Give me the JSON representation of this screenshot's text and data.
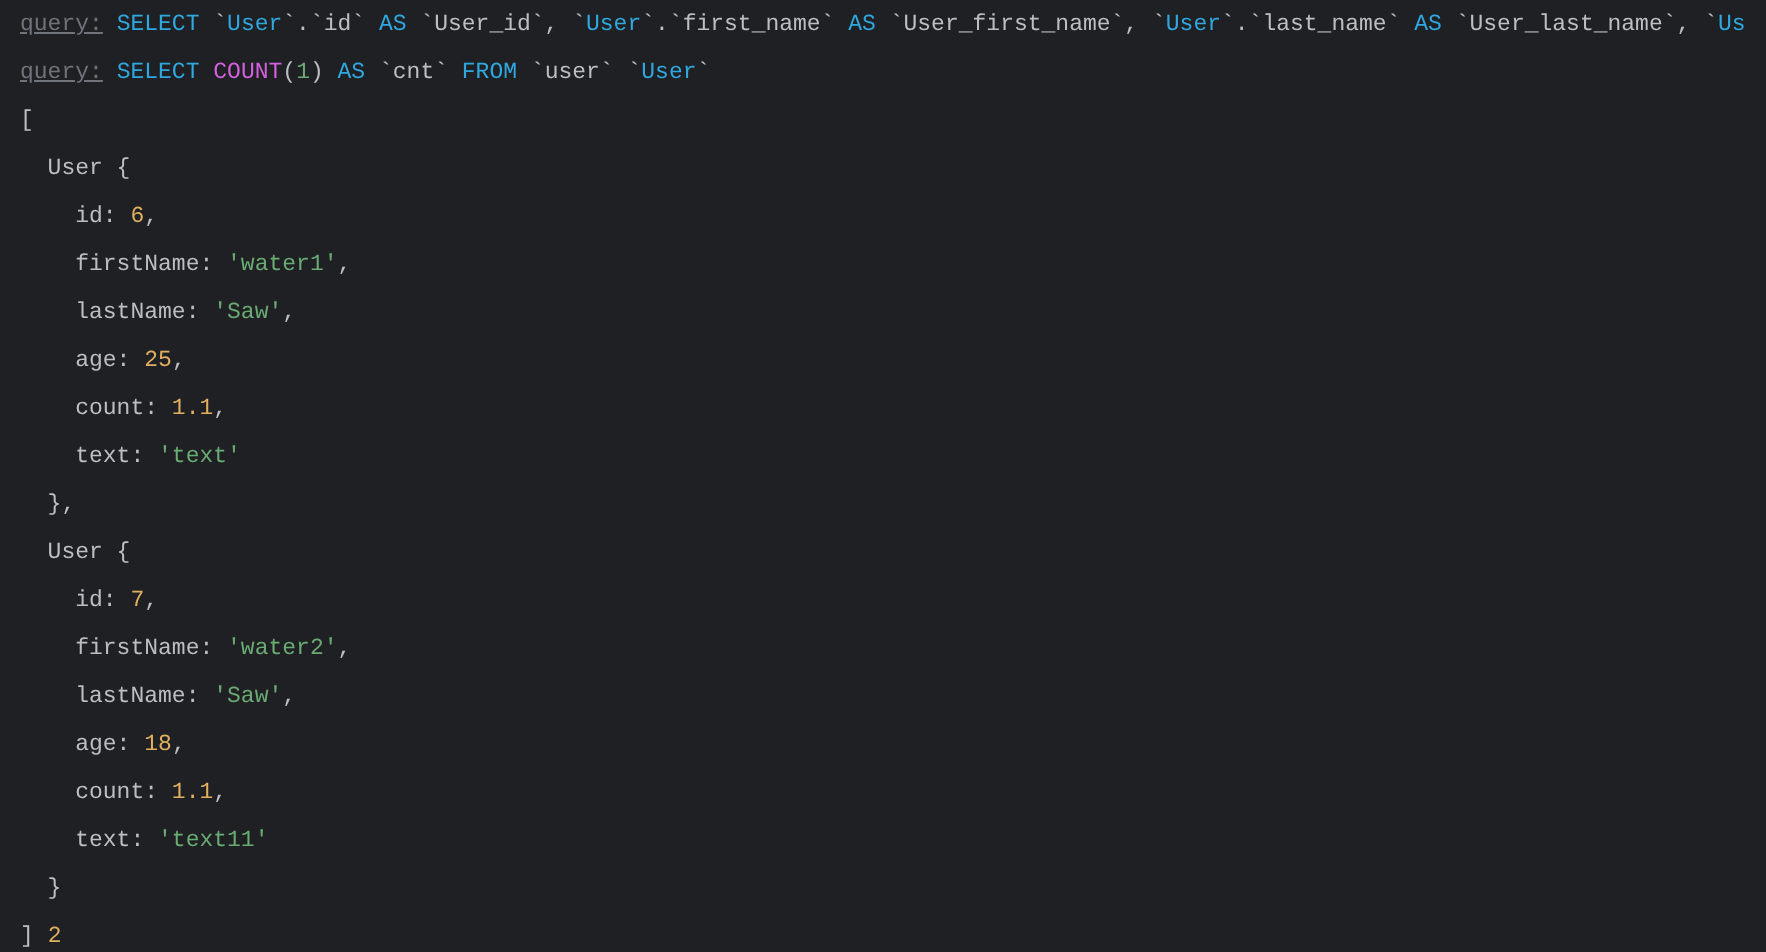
{
  "console": {
    "lines": [
      [
        {
          "kind": "label",
          "text": "query:"
        },
        {
          "kind": "keyword",
          "text": " SELECT"
        },
        {
          "kind": "plain",
          "text": " `"
        },
        {
          "kind": "ident",
          "text": "User"
        },
        {
          "kind": "plain",
          "text": "`.`id` "
        },
        {
          "kind": "keyword",
          "text": "AS"
        },
        {
          "kind": "plain",
          "text": " `User_id`, `"
        },
        {
          "kind": "ident",
          "text": "User"
        },
        {
          "kind": "plain",
          "text": "`.`first_name` "
        },
        {
          "kind": "keyword",
          "text": "AS"
        },
        {
          "kind": "plain",
          "text": " `User_first_name`, `"
        },
        {
          "kind": "ident",
          "text": "User"
        },
        {
          "kind": "plain",
          "text": "`.`last_name` "
        },
        {
          "kind": "keyword",
          "text": "AS"
        },
        {
          "kind": "plain",
          "text": " `User_last_name`, `"
        },
        {
          "kind": "ident",
          "text": "Us"
        }
      ],
      [
        {
          "kind": "label",
          "text": "query:"
        },
        {
          "kind": "keyword",
          "text": " SELECT"
        },
        {
          "kind": "function",
          "text": " COUNT"
        },
        {
          "kind": "plain",
          "text": "("
        },
        {
          "kind": "string",
          "text": "1"
        },
        {
          "kind": "plain",
          "text": ") "
        },
        {
          "kind": "keyword",
          "text": "AS"
        },
        {
          "kind": "plain",
          "text": " `cnt` "
        },
        {
          "kind": "keyword",
          "text": "FROM"
        },
        {
          "kind": "plain",
          "text": " `user` `"
        },
        {
          "kind": "ident",
          "text": "User"
        },
        {
          "kind": "plain",
          "text": "`"
        }
      ],
      [
        {
          "kind": "plain",
          "text": "["
        }
      ],
      [
        {
          "kind": "plain",
          "text": "  User {"
        }
      ],
      [
        {
          "kind": "plain",
          "text": "    id: "
        },
        {
          "kind": "number",
          "text": "6"
        },
        {
          "kind": "plain",
          "text": ","
        }
      ],
      [
        {
          "kind": "plain",
          "text": "    firstName: "
        },
        {
          "kind": "string",
          "text": "'water1'"
        },
        {
          "kind": "plain",
          "text": ","
        }
      ],
      [
        {
          "kind": "plain",
          "text": "    lastName: "
        },
        {
          "kind": "string",
          "text": "'Saw'"
        },
        {
          "kind": "plain",
          "text": ","
        }
      ],
      [
        {
          "kind": "plain",
          "text": "    age: "
        },
        {
          "kind": "number",
          "text": "25"
        },
        {
          "kind": "plain",
          "text": ","
        }
      ],
      [
        {
          "kind": "plain",
          "text": "    count: "
        },
        {
          "kind": "number",
          "text": "1.1"
        },
        {
          "kind": "plain",
          "text": ","
        }
      ],
      [
        {
          "kind": "plain",
          "text": "    text: "
        },
        {
          "kind": "string",
          "text": "'text'"
        }
      ],
      [
        {
          "kind": "plain",
          "text": "  },"
        }
      ],
      [
        {
          "kind": "plain",
          "text": "  User {"
        }
      ],
      [
        {
          "kind": "plain",
          "text": "    id: "
        },
        {
          "kind": "number",
          "text": "7"
        },
        {
          "kind": "plain",
          "text": ","
        }
      ],
      [
        {
          "kind": "plain",
          "text": "    firstName: "
        },
        {
          "kind": "string",
          "text": "'water2'"
        },
        {
          "kind": "plain",
          "text": ","
        }
      ],
      [
        {
          "kind": "plain",
          "text": "    lastName: "
        },
        {
          "kind": "string",
          "text": "'Saw'"
        },
        {
          "kind": "plain",
          "text": ","
        }
      ],
      [
        {
          "kind": "plain",
          "text": "    age: "
        },
        {
          "kind": "number",
          "text": "18"
        },
        {
          "kind": "plain",
          "text": ","
        }
      ],
      [
        {
          "kind": "plain",
          "text": "    count: "
        },
        {
          "kind": "number",
          "text": "1.1"
        },
        {
          "kind": "plain",
          "text": ","
        }
      ],
      [
        {
          "kind": "plain",
          "text": "    text: "
        },
        {
          "kind": "string",
          "text": "'text11'"
        }
      ],
      [
        {
          "kind": "plain",
          "text": "  }"
        }
      ],
      [
        {
          "kind": "plain",
          "text": "] "
        },
        {
          "kind": "number",
          "text": "2"
        }
      ]
    ]
  }
}
